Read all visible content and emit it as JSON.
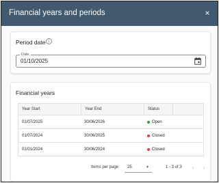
{
  "dialog": {
    "title": "Financial years and periods",
    "close_glyph": "×",
    "header_color": "#425a70"
  },
  "period_date": {
    "title": "Period date",
    "info_icon": "info-circle-icon",
    "info_glyph": "i",
    "field_label": "Date",
    "field_value": "01/10/2025",
    "calendar_icon": "calendar-icon"
  },
  "financial_years": {
    "title": "Financial years",
    "columns": [
      "Year Start",
      "Year End",
      "Status",
      ""
    ],
    "rows": [
      {
        "start": "01/07/2025",
        "end": "30/06/2026",
        "status": "Open",
        "status_color": "#2e9d3c"
      },
      {
        "start": "01/07/2024",
        "end": "30/06/2025",
        "status": "Closed",
        "status_color": "#e23a4a"
      },
      {
        "start": "01/01/2024",
        "end": "30/06/2024",
        "status": "Closed",
        "status_color": "#e23a4a"
      }
    ]
  },
  "paginator": {
    "items_per_page_label": "Items per page",
    "items_per_page_value": "25",
    "dropdown_glyph": "▼",
    "range_label": "1 - 3 of 3",
    "prev_glyph": "‹",
    "next_glyph": "›"
  }
}
